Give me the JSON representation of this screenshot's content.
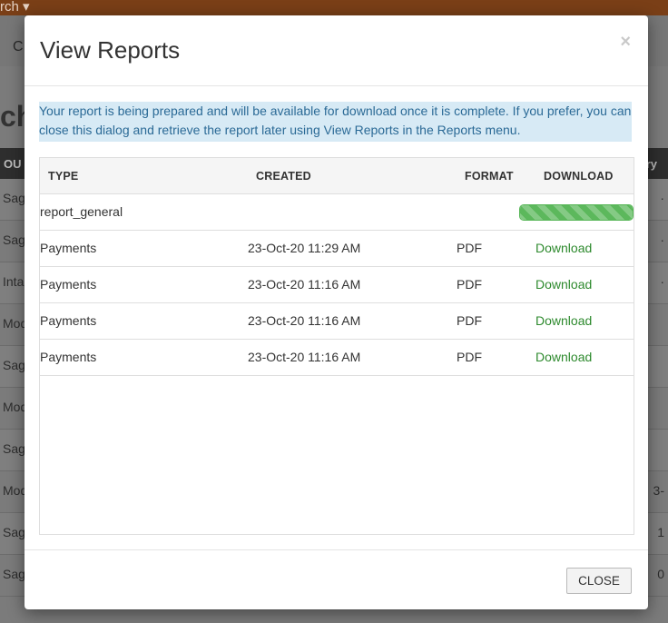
{
  "background": {
    "nav_fragment": "rch ▾",
    "subbar_fragment": "C",
    "title_fragment": "ch",
    "col_left": "OU",
    "col_right": "ry",
    "rows": [
      {
        "left": "Sag",
        "right": "·"
      },
      {
        "left": "Sag",
        "right": "·"
      },
      {
        "left": "Inta",
        "right": "·"
      },
      {
        "left": "Mod",
        "right": ""
      },
      {
        "left": "Sag",
        "right": ""
      },
      {
        "left": "Mod",
        "right": ""
      },
      {
        "left": "Sag",
        "right": ""
      },
      {
        "left": "Mod",
        "right": "3-"
      },
      {
        "left": "Sag",
        "right": "1"
      },
      {
        "left": "Sag",
        "right": "0"
      }
    ]
  },
  "modal": {
    "title": "View Reports",
    "close_icon": "×",
    "info_message": "Your report is being prepared and will be available for download once it is complete. If you prefer, you can close this dialog and retrieve the report later using View Reports in the Reports menu.",
    "columns": {
      "type": "TYPE",
      "created": "CREATED",
      "format": "FORMAT",
      "download": "DOWNLOAD"
    },
    "pending": {
      "type": "report_general",
      "progress": 1.0
    },
    "rows": [
      {
        "type": "Payments",
        "created": "23-Oct-20 11:29 AM",
        "format": "PDF",
        "download": "Download"
      },
      {
        "type": "Payments",
        "created": "23-Oct-20 11:16 AM",
        "format": "PDF",
        "download": "Download"
      },
      {
        "type": "Payments",
        "created": "23-Oct-20 11:16 AM",
        "format": "PDF",
        "download": "Download"
      },
      {
        "type": "Payments",
        "created": "23-Oct-20 11:16 AM",
        "format": "PDF",
        "download": "Download"
      }
    ],
    "close_button": "CLOSE"
  },
  "colors": {
    "topbar": "#7a3f17",
    "info_bg": "#d7eaf5",
    "info_text": "#2b6a96",
    "link": "#2e8a2e",
    "progress": "#5cb85c"
  }
}
